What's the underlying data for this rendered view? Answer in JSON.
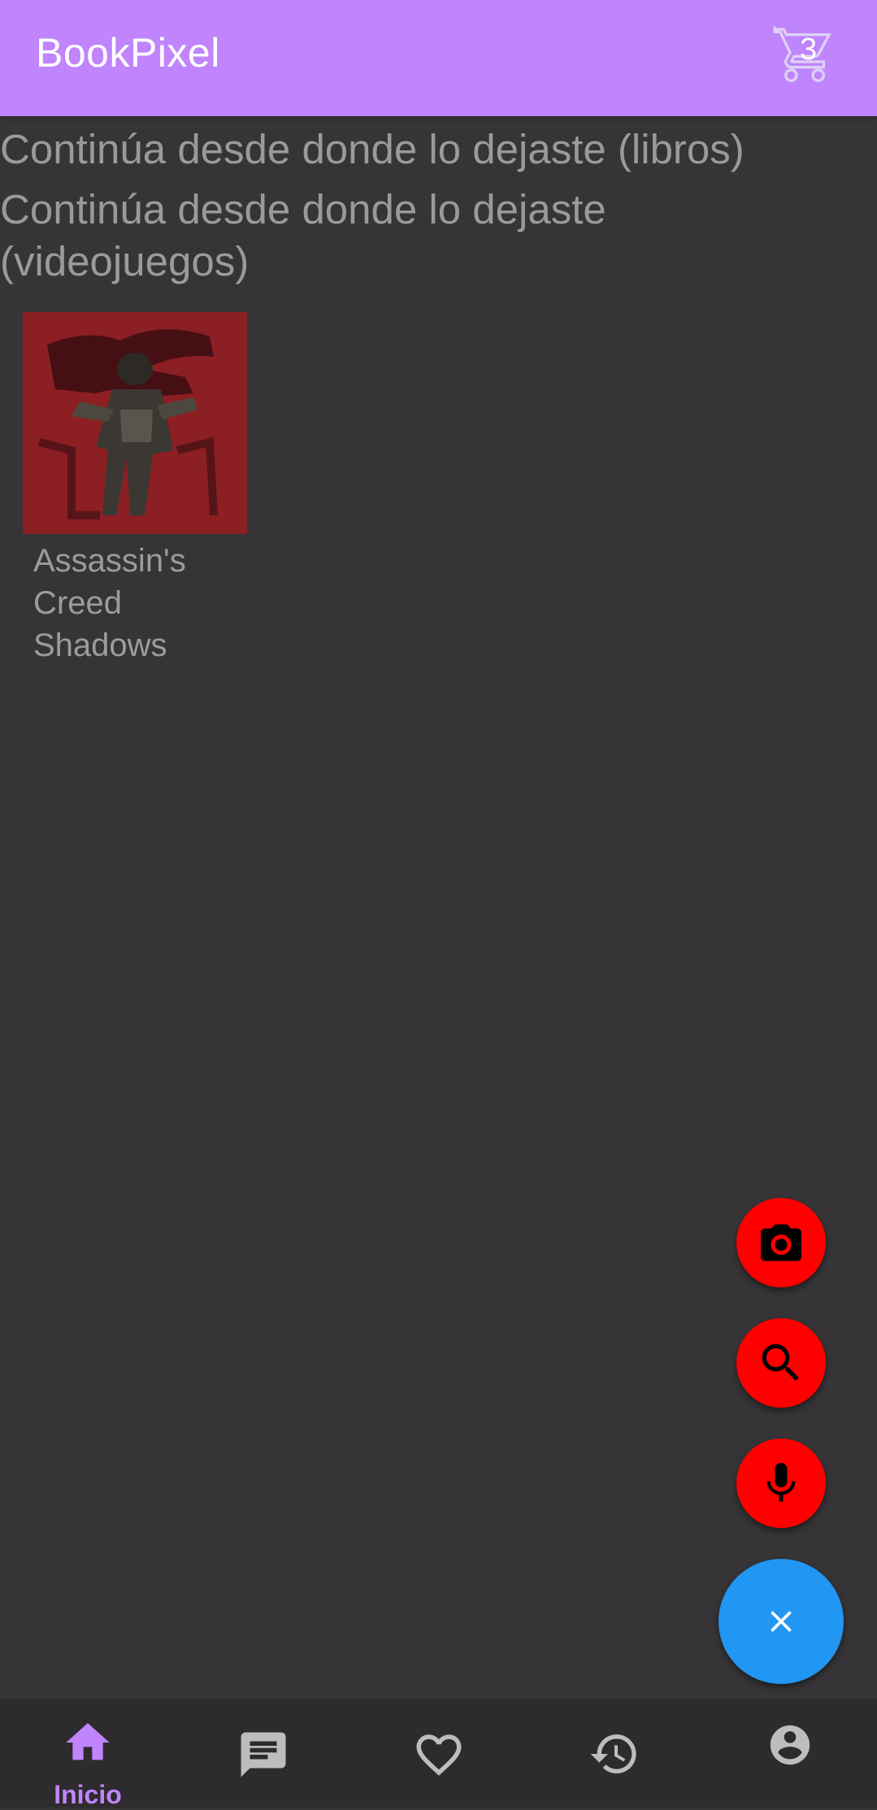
{
  "appbar": {
    "title": "BookPixel",
    "cart_icon": "cart-icon",
    "cart_count": "3"
  },
  "sections": {
    "books_title": "Continúa desde donde lo dejaste (libros)",
    "games_title": "Continúa desde donde lo dejaste (videojuegos)"
  },
  "games": [
    {
      "title": "Assassin's Creed Shadows",
      "cover_icon": "game-cover-image"
    }
  ],
  "fabs": {
    "camera_icon": "camera-icon",
    "search_icon": "search-icon",
    "mic_icon": "mic-icon",
    "close_icon": "close-icon"
  },
  "bottom_nav": {
    "items": [
      {
        "label": "Inicio",
        "icon": "home-icon",
        "active": true
      },
      {
        "label": "",
        "icon": "chat-icon",
        "active": false
      },
      {
        "label": "",
        "icon": "heart-icon",
        "active": false
      },
      {
        "label": "",
        "icon": "history-icon",
        "active": false
      },
      {
        "label": "",
        "icon": "account-icon",
        "active": false
      }
    ]
  },
  "colors": {
    "appbar": "#c084fc",
    "background": "#363436",
    "fab_small": "#ff0000",
    "fab_main": "#2196f3",
    "nav_active": "#c084fc",
    "nav_inactive": "#bdbdbd"
  }
}
